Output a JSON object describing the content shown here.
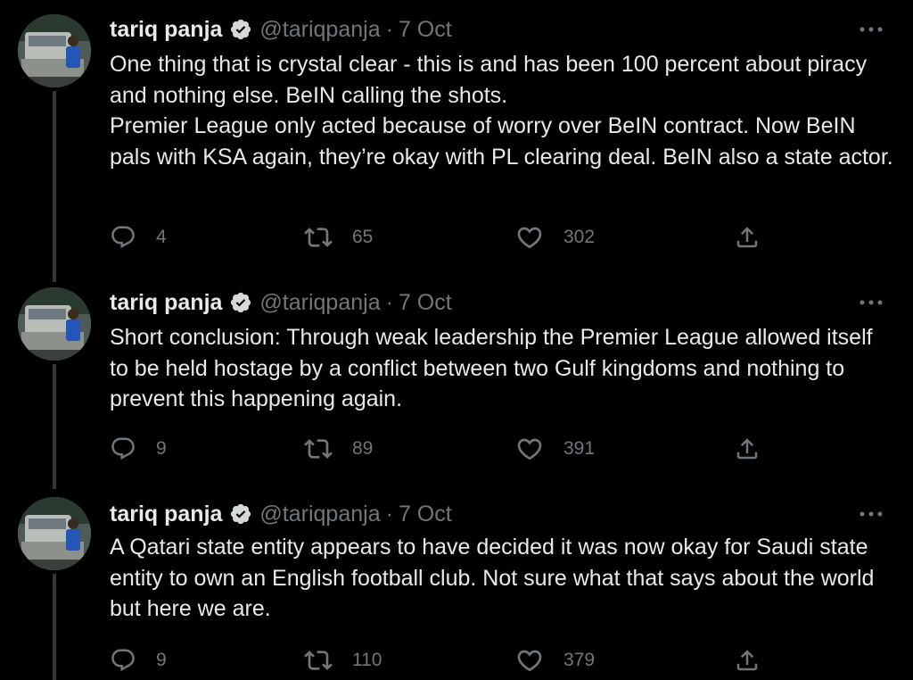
{
  "author": {
    "display_name": "tariq panja",
    "handle": "@tariqpanja",
    "separator": "·"
  },
  "colors": {
    "background": "#000000",
    "text": "#e7e9ea",
    "muted": "#71767b",
    "thread_line": "#333639"
  },
  "tweets": [
    {
      "date": "7 Oct",
      "text": "One thing that is crystal clear - this is and has been 100 percent about piracy and nothing else. BeIN calling the shots.\nPremier League only acted because of worry over BeIN contract. Now BeIN pals with KSA again, they’re okay with PL clearing deal. BeIN also a state actor.",
      "replies": "4",
      "retweets": "65",
      "likes": "302"
    },
    {
      "date": "7 Oct",
      "text": "Short conclusion: Through weak leadership the Premier League allowed itself to be held hostage by a conflict between two Gulf kingdoms and nothing to prevent this happening again.",
      "replies": "9",
      "retweets": "89",
      "likes": "391"
    },
    {
      "date": "7 Oct",
      "text": "A Qatari state entity appears to have decided it was now okay for Saudi state entity to own an English football club. Not sure what that says about the world but here we are.",
      "replies": "9",
      "retweets": "110",
      "likes": "379"
    }
  ],
  "icons": {
    "verified": "verified-badge-icon",
    "more": "more-options-icon",
    "reply": "reply-icon",
    "retweet": "retweet-icon",
    "like": "heart-icon",
    "share": "share-icon"
  }
}
